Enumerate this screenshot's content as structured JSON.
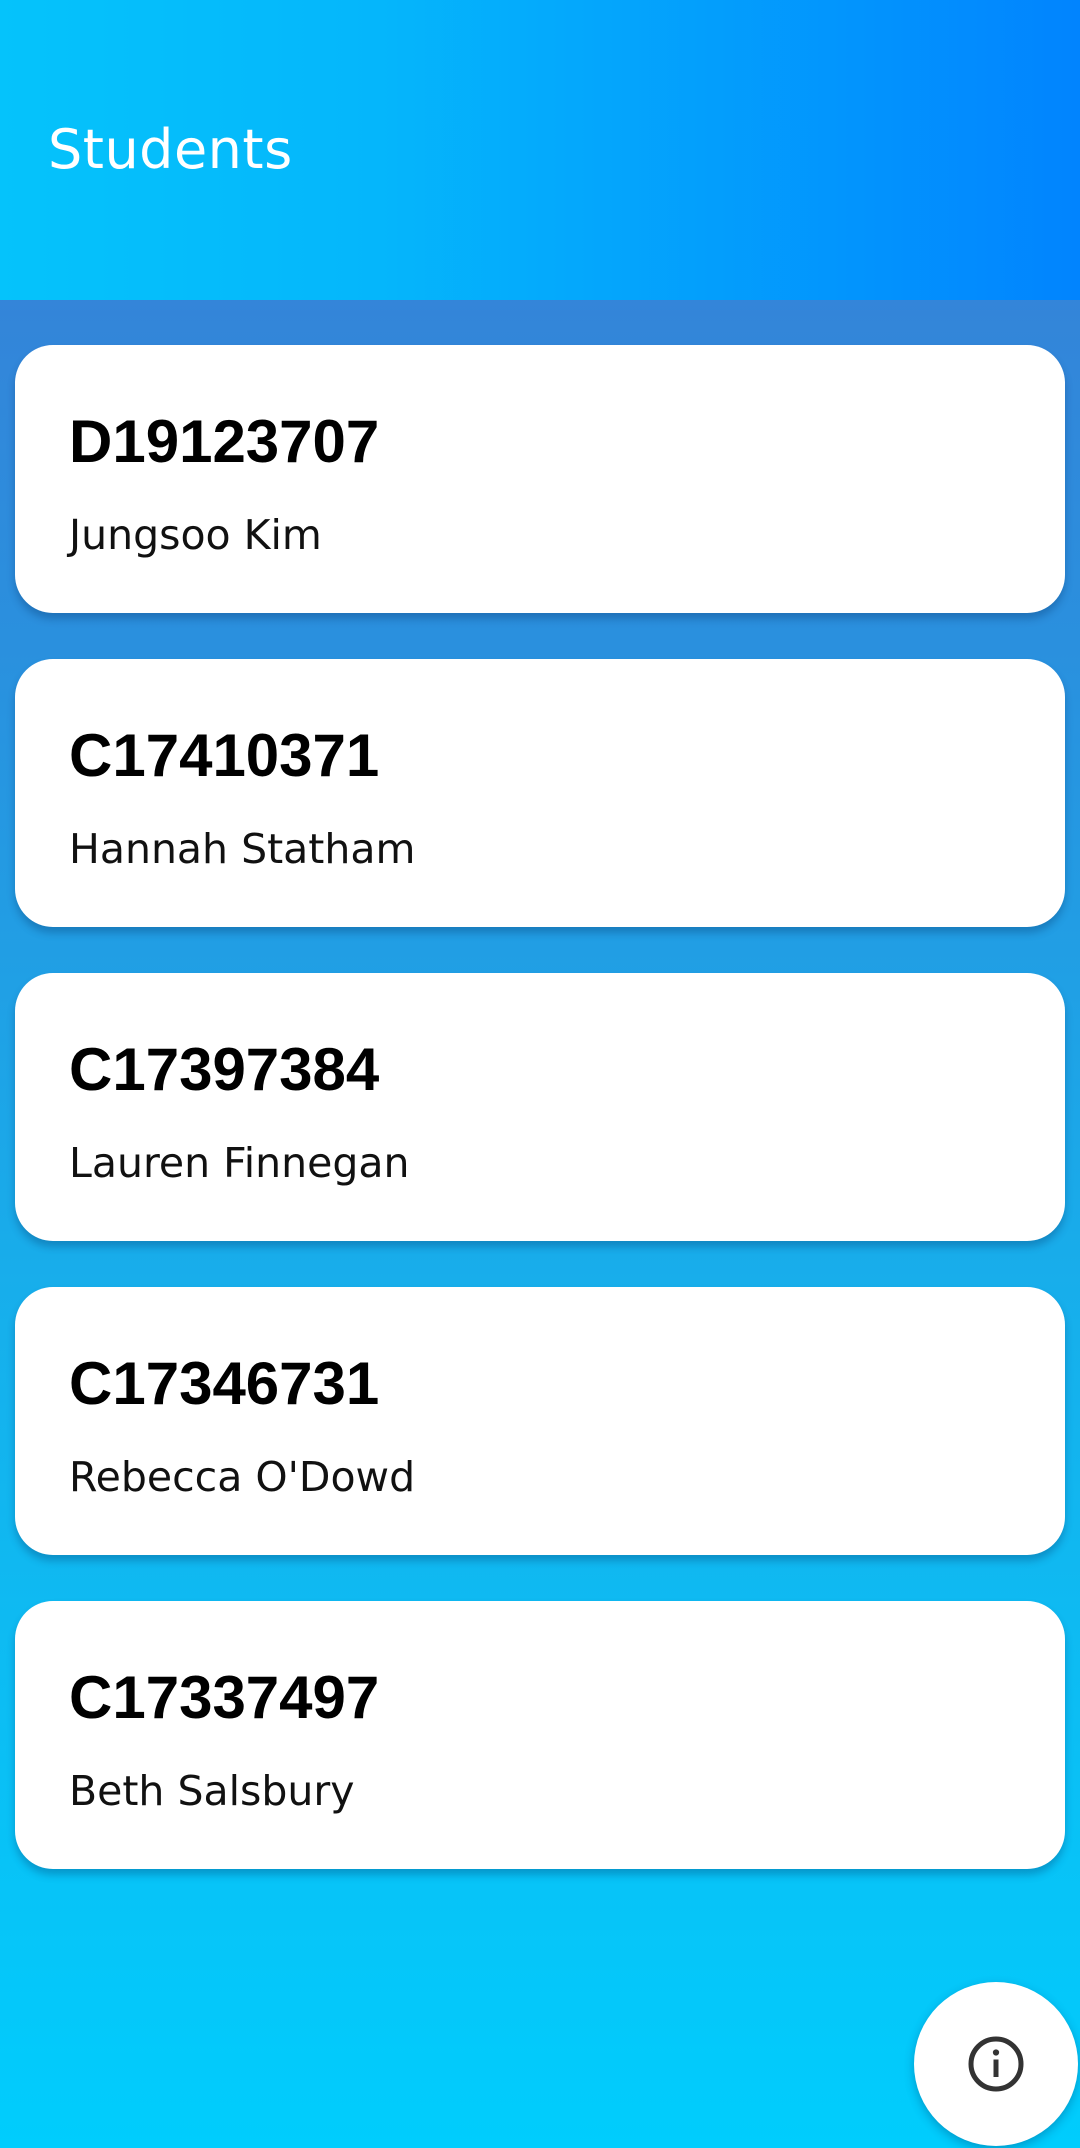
{
  "app_bar": {
    "title": "Students"
  },
  "students": [
    {
      "id": "D19123707",
      "name": "Jungsoo Kim"
    },
    {
      "id": "C17410371",
      "name": "Hannah Statham"
    },
    {
      "id": "C17397384",
      "name": "Lauren Finnegan"
    },
    {
      "id": "C17346731",
      "name": "Rebecca O'Dowd"
    },
    {
      "id": "C17337497",
      "name": "Beth Salsbury"
    }
  ],
  "fab": {
    "icon": "info-icon"
  },
  "colors": {
    "app_bar_start": "#05c3fb",
    "app_bar_end": "#0184fe",
    "background_top": "#3c7bd4",
    "background_bottom": "#00cdfd",
    "card": "#ffffff",
    "icon": "#333333"
  }
}
